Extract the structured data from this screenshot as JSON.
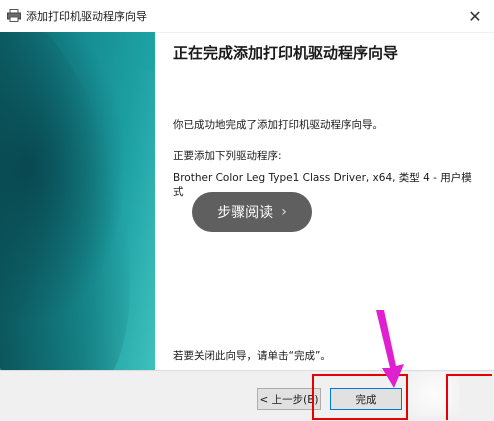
{
  "window": {
    "title": "添加打印机驱动程序向导",
    "close_symbol": "✕"
  },
  "content": {
    "heading": "正在完成添加打印机驱动程序向导",
    "success_text": "你已成功地完成了添加打印机驱动程序向导。",
    "adding_label": "正要添加下列驱动程序:",
    "driver_info": "Brother Color Leg Type1 Class Driver, x64, 类型 4 - 用户模式",
    "footer_text": "若要关闭此向导，请单击“完成”。"
  },
  "buttons": {
    "back_label": "< 上一步(B)",
    "finish_label": "完成"
  },
  "overlay": {
    "label": "步骤阅读",
    "chevron": "›"
  },
  "colors": {
    "accent_blue": "#0078d7",
    "annotation_red": "#e60000",
    "annotation_magenta": "#e020d0",
    "panel_teal": "#168d92"
  },
  "icons": {
    "title": "printer-icon",
    "close": "close-icon",
    "arrow": "arrow-annotation-icon"
  }
}
